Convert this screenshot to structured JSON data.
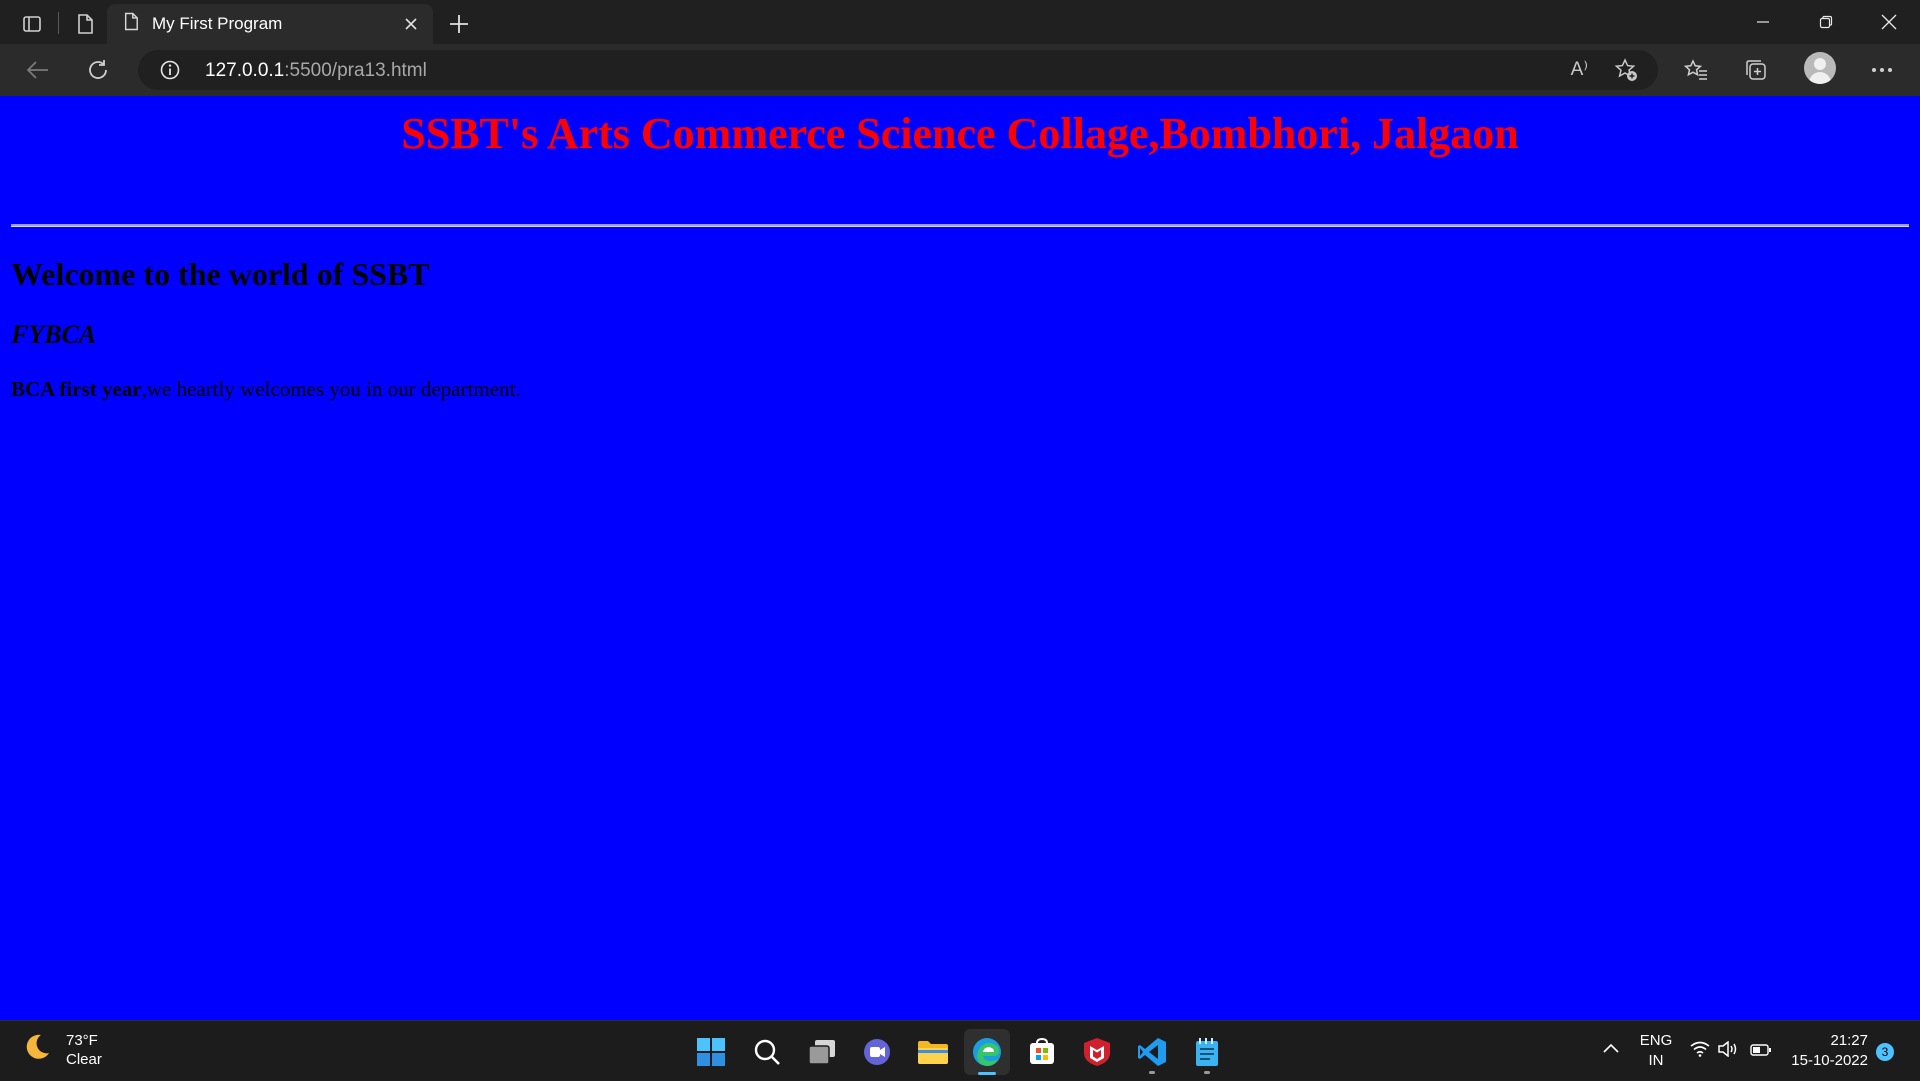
{
  "browser": {
    "tab": {
      "title": "My First Program"
    },
    "address": {
      "host": "127.0.0.1",
      "rest": ":5500/pra13.html"
    },
    "read_aloud_label": "A⁾"
  },
  "page": {
    "heading": "SSBT's Arts Commerce Science Collage,Bombhori, Jalgaon",
    "welcome": "Welcome to the world of SSBT",
    "class_name": "FYBCA",
    "intro_bold": "BCA first year",
    "intro_rest": ",we heartly welcomes you in our department."
  },
  "taskbar": {
    "weather": {
      "temp": "73°F",
      "condition": "Clear"
    },
    "lang": {
      "line1": "ENG",
      "line2": "IN"
    },
    "clock": {
      "time": "21:27",
      "date": "15-10-2022"
    },
    "notification_count": "3",
    "apps": [
      "start-icon",
      "search-icon",
      "task-view-icon",
      "teams-chat-icon",
      "file-explorer-icon",
      "edge-icon",
      "microsoft-store-icon",
      "mcafee-icon",
      "vscode-icon",
      "notepad-icon"
    ]
  },
  "colors": {
    "page_background": "#0000ff",
    "heading": "#ff0000",
    "accent": "#4cc2ff"
  }
}
